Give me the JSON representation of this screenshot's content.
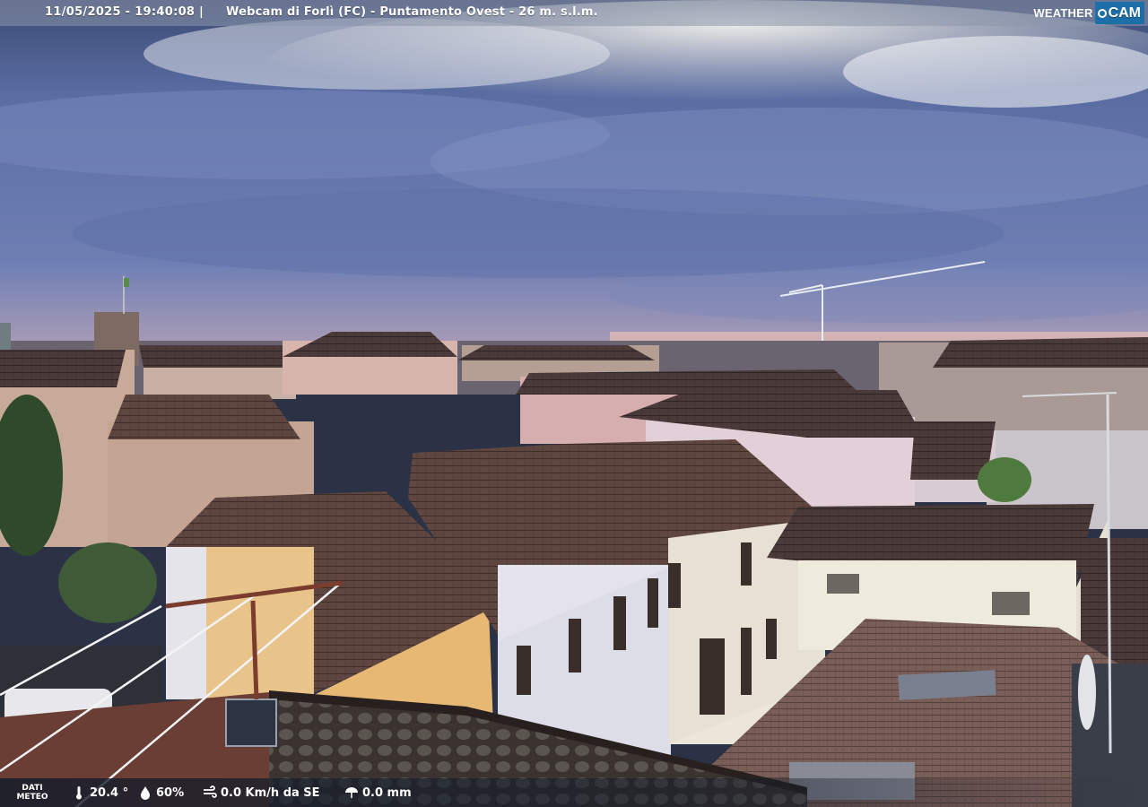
{
  "header": {
    "datetime": "11/05/2025 - 19:40:08",
    "separator": "|",
    "caption": "Webcam di Forlì (FC) - Puntamento Ovest - 26 m. s.l.m."
  },
  "logo": {
    "weather": "WEATHER",
    "cam": "CAM"
  },
  "weather": {
    "label_line1": "DATI",
    "label_line2": "METEO",
    "temperature": "20.4 °",
    "humidity": "60%",
    "wind": "0.0 Km/h da SE",
    "rain": "0.0 mm",
    "icons": [
      "thermometer-icon",
      "humidity-icon",
      "wind-icon",
      "rain-icon"
    ]
  },
  "colors": {
    "sky_top": "#3c4d78",
    "sky_mid": "#6479b0",
    "horizon": "#e8c0b8",
    "roof": "#5a423c",
    "accent": "#1d6fa8"
  }
}
